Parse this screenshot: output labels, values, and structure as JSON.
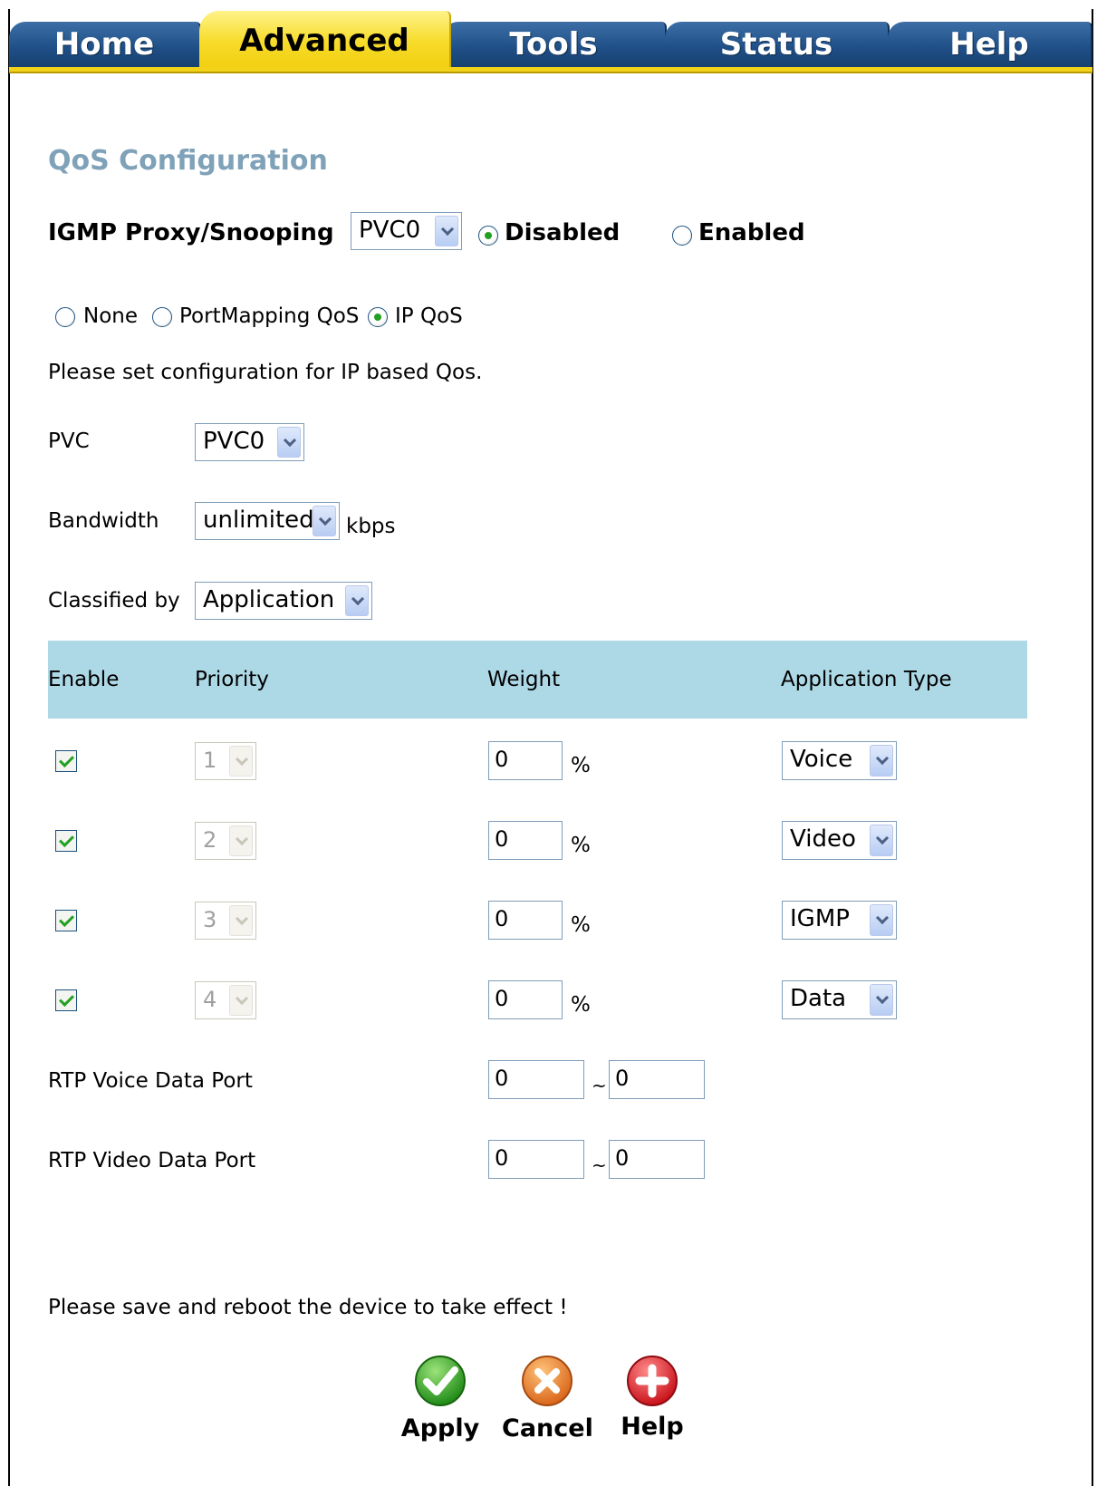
{
  "tabs": [
    {
      "label": "Home",
      "active": false
    },
    {
      "label": "Advanced",
      "active": true
    },
    {
      "label": "Tools",
      "active": false
    },
    {
      "label": "Status",
      "active": false
    },
    {
      "label": "Help",
      "active": false
    }
  ],
  "page_title": "QoS Configuration",
  "igmp": {
    "label": "IGMP Proxy/Snooping",
    "pvc_value": "PVC0",
    "options": [
      {
        "label": "Disabled",
        "checked": true
      },
      {
        "label": "Enabled",
        "checked": false
      }
    ]
  },
  "qos_mode": [
    {
      "label": "None",
      "checked": false
    },
    {
      "label": "PortMapping QoS",
      "checked": false
    },
    {
      "label": "IP QoS",
      "checked": true
    }
  ],
  "instruction": "Please set configuration for IP based Qos.",
  "pvc": {
    "label": "PVC",
    "value": "PVC0"
  },
  "bandwidth": {
    "label": "Bandwidth",
    "value": "unlimited",
    "unit": "kbps"
  },
  "classified_by": {
    "label": "Classified by",
    "value": "Application"
  },
  "table": {
    "headers": [
      "Enable",
      "Priority",
      "Weight",
      "Application Type"
    ],
    "rows": [
      {
        "enabled": true,
        "priority": "1",
        "weight": "0",
        "unit": "%",
        "app_type": "Voice"
      },
      {
        "enabled": true,
        "priority": "2",
        "weight": "0",
        "unit": "%",
        "app_type": "Video"
      },
      {
        "enabled": true,
        "priority": "3",
        "weight": "0",
        "unit": "%",
        "app_type": "IGMP"
      },
      {
        "enabled": true,
        "priority": "4",
        "weight": "0",
        "unit": "%",
        "app_type": "Data"
      }
    ]
  },
  "rtp_voice": {
    "label": "RTP Voice Data Port",
    "from": "0",
    "sep": "~",
    "to": "0"
  },
  "rtp_video": {
    "label": "RTP Video Data Port",
    "from": "0",
    "sep": "~",
    "to": "0"
  },
  "notice": "Please save and reboot the device to take effect !",
  "buttons": {
    "apply": "Apply",
    "cancel": "Cancel",
    "help": "Help"
  },
  "colors": {
    "tab_blue": "#1f4e86",
    "tab_active_yellow": "#f7dc2a",
    "title": "#7fa2b8",
    "table_header": "#add8e6",
    "check_green": "#21a121"
  }
}
